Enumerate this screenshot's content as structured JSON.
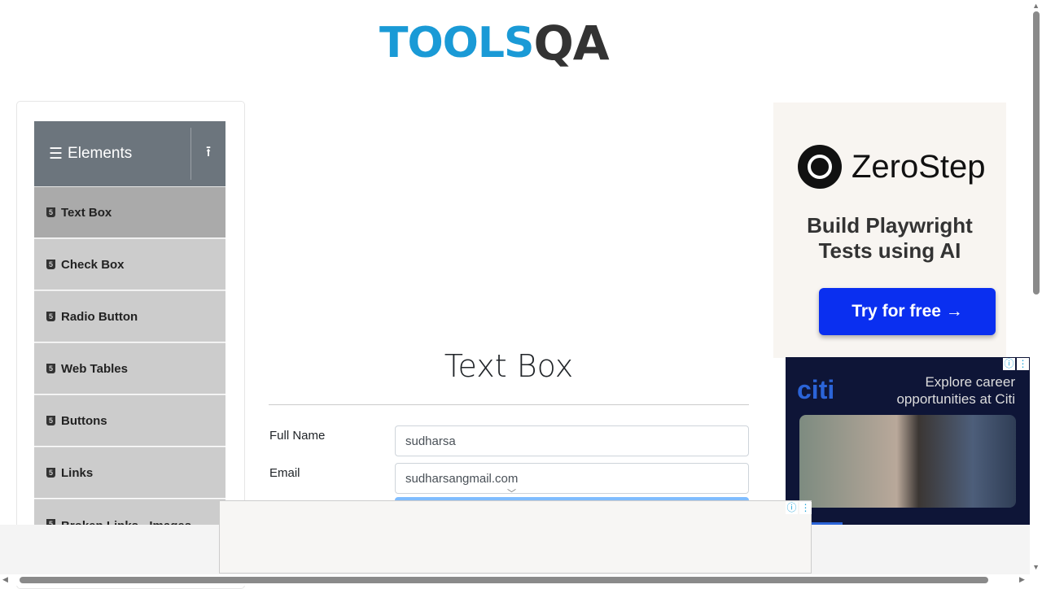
{
  "logo": {
    "text1": "TOOLS",
    "text2": "QA"
  },
  "sidebar": {
    "group": "Elements",
    "items": [
      {
        "label": "Text Box"
      },
      {
        "label": "Check Box"
      },
      {
        "label": "Radio Button"
      },
      {
        "label": "Web Tables"
      },
      {
        "label": "Buttons"
      },
      {
        "label": "Links"
      },
      {
        "label": "Broken Links - Images"
      }
    ]
  },
  "main": {
    "title": "Text Box",
    "full_name_label": "Full Name",
    "full_name_value": "sudharsa",
    "email_label": "Email",
    "email_value": "sudharsangmail.com"
  },
  "ad_zerostep": {
    "brand": "ZeroStep",
    "tagline1": "Build Playwright",
    "tagline2": "Tests using AI",
    "cta": "Try for free →"
  },
  "ad_citi": {
    "brand": "citi",
    "line1": "Explore career",
    "line2": "opportunities at Citi"
  }
}
